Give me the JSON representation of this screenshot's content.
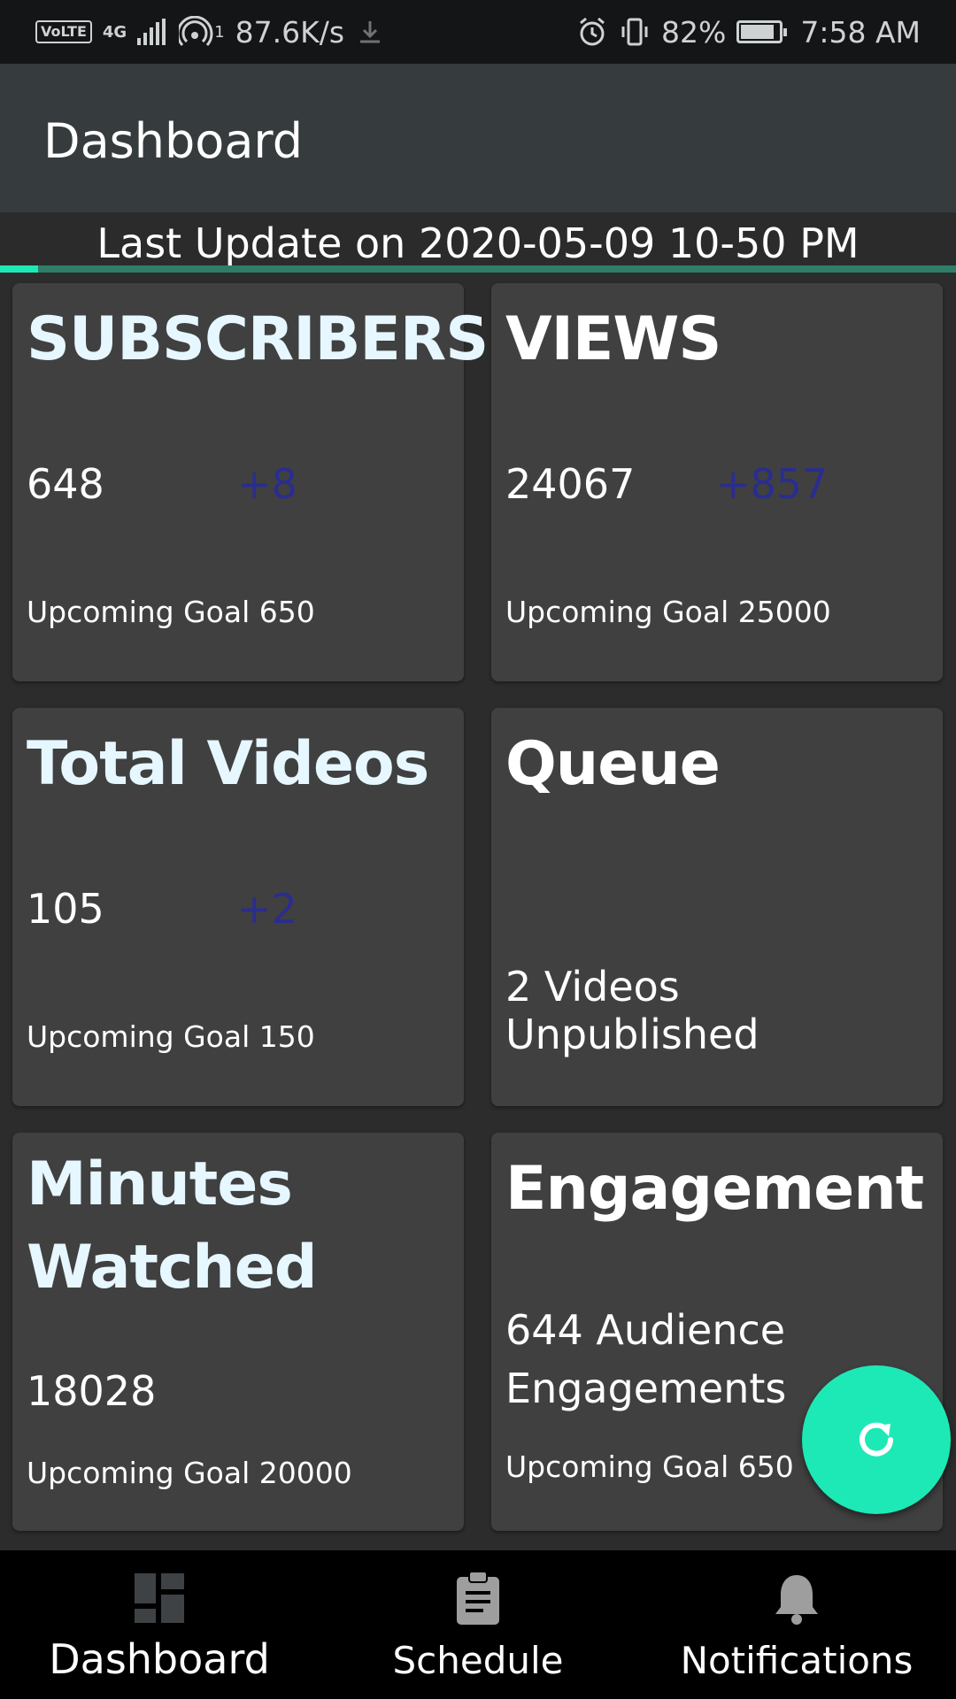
{
  "status_bar": {
    "volte": "VoLTE",
    "network": "4G",
    "hotspot_count": "1",
    "speed": "87.6K/s",
    "battery": "82%",
    "time": "7:58 AM"
  },
  "app_bar": {
    "title": "Dashboard"
  },
  "update": {
    "text": "Last Update on 2020-05-09   10-50 PM",
    "progress": 0.04
  },
  "cards": {
    "subscribers": {
      "title": "SUBSCRIBERS",
      "value": "648",
      "delta": "+8",
      "goal": "Upcoming Goal 650"
    },
    "views": {
      "title": "VIEWS",
      "value": "24067",
      "delta": "+857",
      "goal": "Upcoming Goal 25000"
    },
    "videos": {
      "title": "Total Videos",
      "value": "105",
      "delta": "+2",
      "goal": "Upcoming Goal 150"
    },
    "queue": {
      "title": "Queue",
      "status": "2 Videos Unpublished"
    },
    "minutes": {
      "title_line1": "Minutes",
      "title_line2": "Watched",
      "value": "18028",
      "goal": "Upcoming Goal 20000"
    },
    "engagement": {
      "title": "Engagement",
      "line1": "644 Audience",
      "line2": "Engagements",
      "goal": "Upcoming Goal 650"
    }
  },
  "fab": {
    "icon": "refresh-icon"
  },
  "bottom_nav": {
    "items": [
      {
        "label": "Dashboard",
        "icon": "dashboard-icon",
        "active": true
      },
      {
        "label": "Schedule",
        "icon": "clipboard-icon",
        "active": false
      },
      {
        "label": "Notifications",
        "icon": "bell-icon",
        "active": false
      }
    ]
  },
  "colors": {
    "accent": "#1de9b6",
    "delta": "#2a2d8f",
    "card": "#404040",
    "app_bar": "#363b3e"
  }
}
